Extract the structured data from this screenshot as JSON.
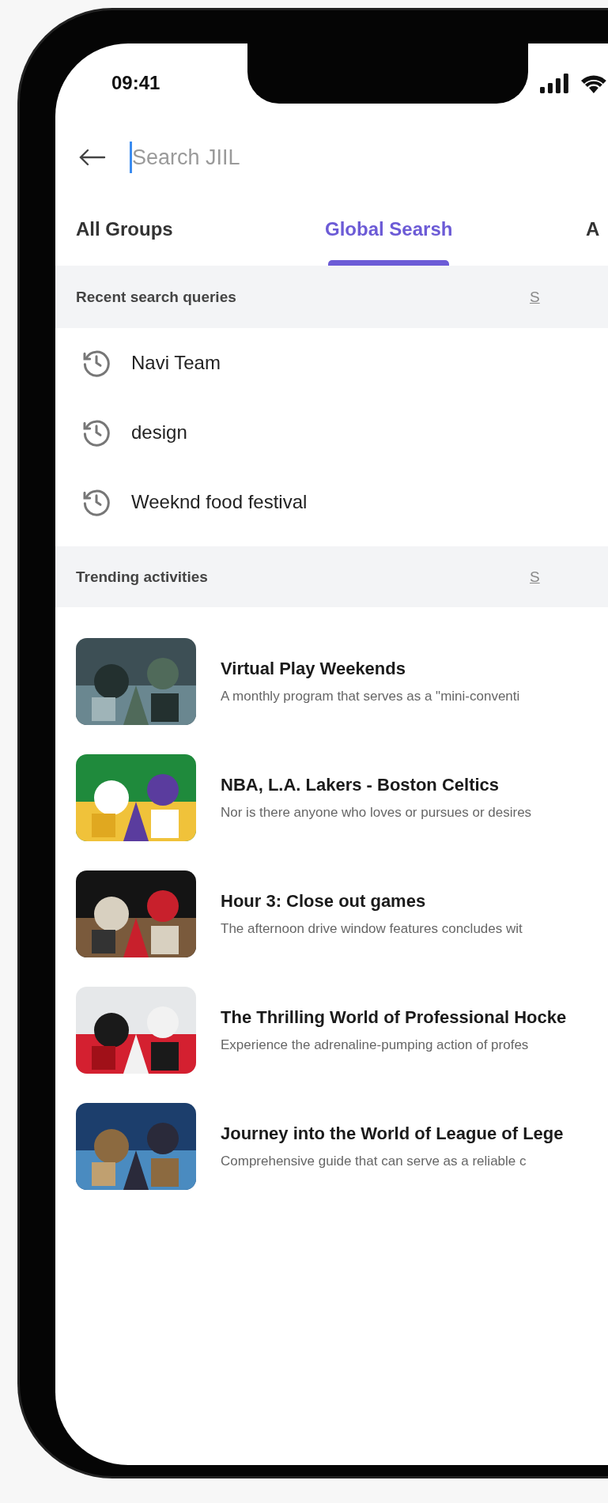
{
  "status_bar": {
    "time": "09:41"
  },
  "search": {
    "placeholder": "Search JIIL",
    "focused": true
  },
  "tabs": [
    {
      "label": "All Groups",
      "selected": false
    },
    {
      "label": "Global Searsh",
      "selected": true
    },
    {
      "label": "A",
      "selected": false
    }
  ],
  "recent": {
    "title": "Recent search queries",
    "action": "S",
    "items": [
      "Navi Team",
      "design",
      "Weeknd food festival"
    ]
  },
  "trending": {
    "title": "Trending activities",
    "action": "S",
    "items": [
      {
        "title": "Virtual Play Weekends",
        "description": "A monthly program that serves as a \"mini-conventi",
        "kind": "picture"
      },
      {
        "title": "NBA, L.A. Lakers - Boston Celtics",
        "description": "Nor is there anyone who loves or pursues or desires",
        "kind": "picture"
      },
      {
        "title": "Hour 3: Close out games",
        "description": "The afternoon drive window features concludes wit",
        "kind": "picture"
      },
      {
        "title": "The Thrilling World of Professional Hocke",
        "description": "Experience the adrenaline-pumping action of profes",
        "kind": "picture"
      },
      {
        "title": "Journey into the World of League of Lege",
        "description": "Comprehensive guide that can serve as a reliable c",
        "kind": "picture"
      }
    ]
  }
}
